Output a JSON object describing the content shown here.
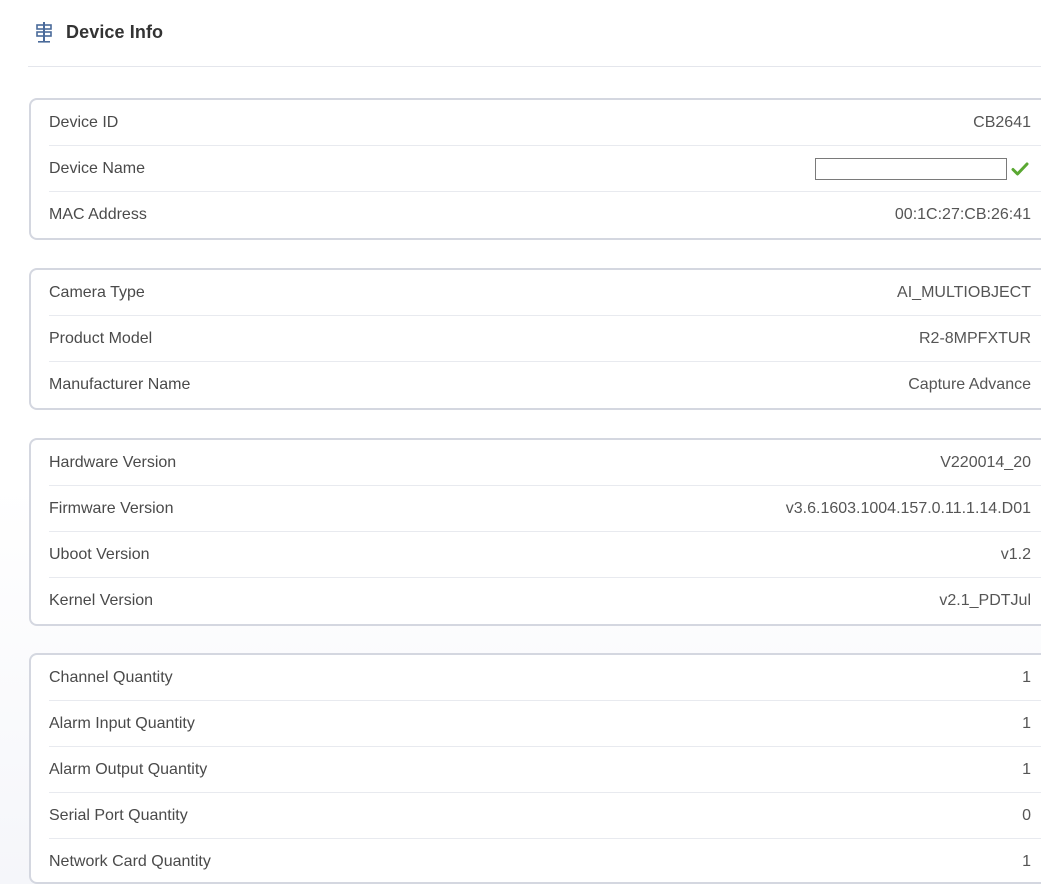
{
  "header": {
    "title": "Device Info",
    "icon": "signpost-icon"
  },
  "device": {
    "id_label": "Device ID",
    "id_value": "CB2641",
    "name_label": "Device Name",
    "name_value": "",
    "name_confirm_icon": "checkmark-icon",
    "mac_label": "MAC Address",
    "mac_value": "00:1C:27:CB:26:41"
  },
  "product": {
    "camera_type_label": "Camera Type",
    "camera_type_value": "AI_MULTIOBJECT",
    "model_label": "Product Model",
    "model_value": "R2-8MPFXTUR",
    "manufacturer_label": "Manufacturer Name",
    "manufacturer_value": "Capture Advance"
  },
  "versions": {
    "hardware_label": "Hardware Version",
    "hardware_value": "V220014_20",
    "firmware_label": "Firmware Version",
    "firmware_value": "v3.6.1603.1004.157.0.11.1.14.D01",
    "uboot_label": "Uboot Version",
    "uboot_value": "v1.2",
    "kernel_label": "Kernel Version",
    "kernel_value": "v2.1_PDTJul"
  },
  "quantities": {
    "channel_label": "Channel Quantity",
    "channel_value": "1",
    "alarm_in_label": "Alarm Input Quantity",
    "alarm_in_value": "1",
    "alarm_out_label": "Alarm Output Quantity",
    "alarm_out_value": "1",
    "serial_label": "Serial Port Quantity",
    "serial_value": "0",
    "nic_label": "Network Card Quantity",
    "nic_value": "1"
  },
  "colors": {
    "check": "#5aa832",
    "panel_border": "#d4d7e0",
    "label_text": "#4a4a4a"
  }
}
